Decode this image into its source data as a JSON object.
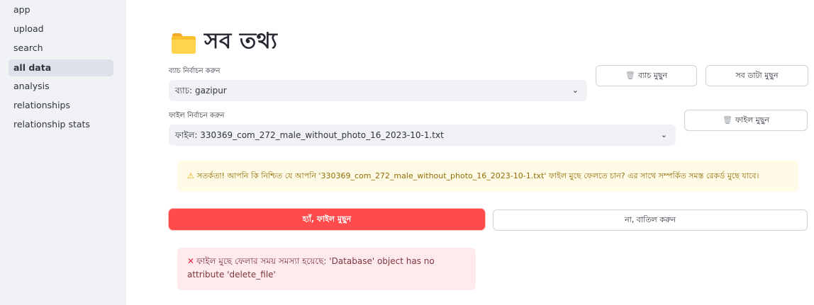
{
  "sidebar": {
    "items": [
      {
        "label": "app",
        "active": false
      },
      {
        "label": "upload",
        "active": false
      },
      {
        "label": "search",
        "active": false
      },
      {
        "label": "all data",
        "active": true
      },
      {
        "label": "analysis",
        "active": false
      },
      {
        "label": "relationships",
        "active": false
      },
      {
        "label": "relationship stats",
        "active": false
      }
    ]
  },
  "page": {
    "title": "সব তথ্য",
    "title_icon": "folder-icon"
  },
  "batch": {
    "label": "ব্যাচ নির্বাচন করুন",
    "selected": "ব্যাচ: gazipur",
    "delete_batch_label": "ব্যাচ মুছুন",
    "delete_all_label": "সব ডাটা মুছুন"
  },
  "file": {
    "label": "ফাইল নির্বাচন করুন",
    "selected": "ফাইল: 330369_com_272_male_without_photo_16_2023-10-1.txt",
    "delete_file_label": "ফাইল মুছুন"
  },
  "warning": {
    "icon": "warning-icon",
    "text": "সতর্কতা! আপনি কি নিশ্চিত যে আপনি '330369_com_272_male_without_photo_16_2023-10-1.txt' ফাইল মুছে ফেলতে চান? এর সাথে সম্পর্কিত সমস্ত রেকর্ড মুছে যাবে।",
    "color": "#926c05",
    "background": "#fffbe6"
  },
  "confirm": {
    "yes_label": "হ্যাঁ, ফাইল মুছুন",
    "no_label": "না, বাতিল করুন",
    "accent": "#ff4b4b"
  },
  "error": {
    "icon": "x-icon",
    "text": "ফাইল মুছে ফেলার সময় সমস্যা হয়েছে: 'Database' object has no attribute 'delete_file'",
    "color": "#7d353b",
    "background": "#ffebed"
  }
}
